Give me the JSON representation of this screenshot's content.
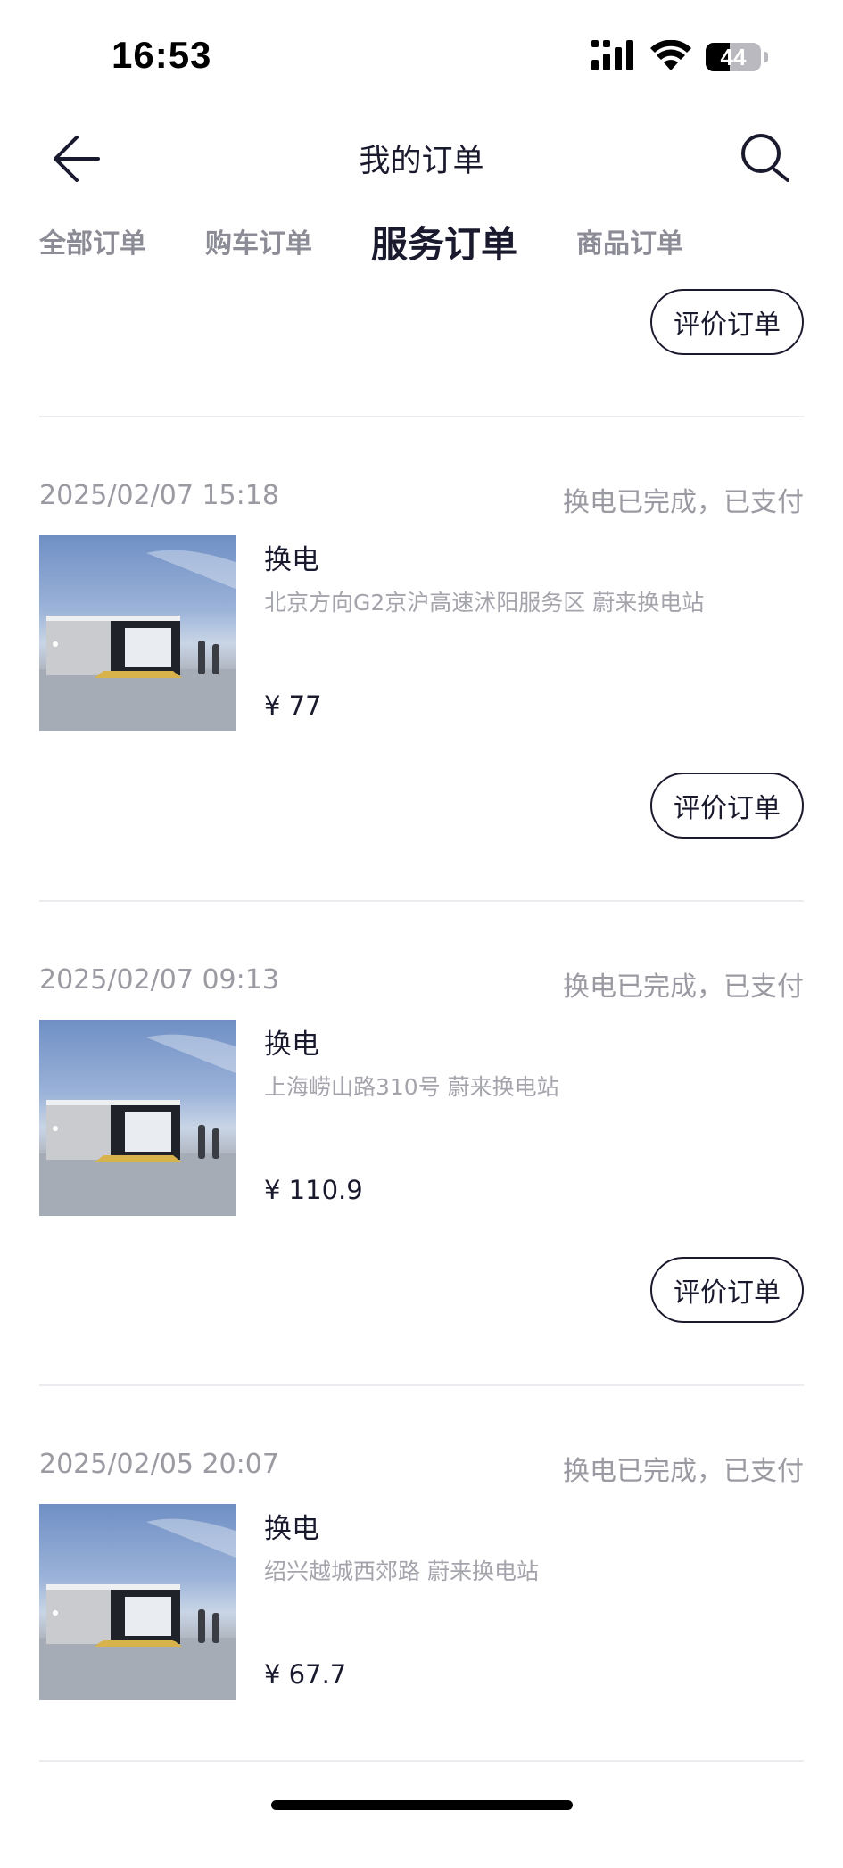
{
  "status_bar": {
    "time": "16:53",
    "battery": "44",
    "battery_level": 0.44
  },
  "header": {
    "title": "我的订单"
  },
  "tabs": [
    {
      "label": "全部订单",
      "active": false
    },
    {
      "label": "购车订单",
      "active": false
    },
    {
      "label": "服务订单",
      "active": true
    },
    {
      "label": "商品订单",
      "active": false
    }
  ],
  "top_action": {
    "rate_label": "评价订单"
  },
  "orders": [
    {
      "date": "2025/02/07 15:18",
      "status": "换电已完成，已支付",
      "name": "换电",
      "address": "北京方向G2京沪高速沭阳服务区 蔚来换电站",
      "price": "¥ 77",
      "rate_label": "评价订单"
    },
    {
      "date": "2025/02/07 09:13",
      "status": "换电已完成，已支付",
      "name": "换电",
      "address": "上海崂山路310号 蔚来换电站",
      "price": "¥ 110.9",
      "rate_label": "评价订单"
    },
    {
      "date": "2025/02/05 20:07",
      "status": "换电已完成，已支付",
      "name": "换电",
      "address": "绍兴越城西郊路 蔚来换电站",
      "price": "¥ 67.7"
    }
  ],
  "colors": {
    "text_primary": "#1a1a2e",
    "text_secondary": "#9a9aa2",
    "divider": "#ececf0"
  }
}
